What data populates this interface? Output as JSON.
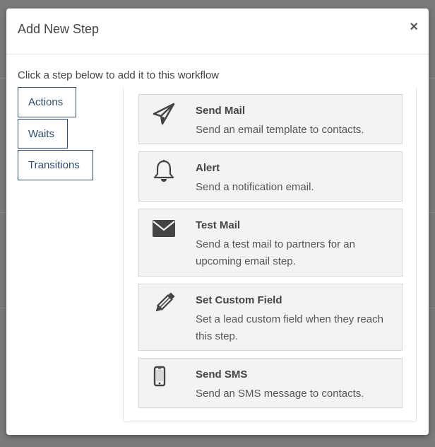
{
  "modal": {
    "title": "Add New Step",
    "close_label": "×",
    "instruction": "Click a step below to add it to this workflow"
  },
  "tabs": [
    {
      "label": "Actions"
    },
    {
      "label": "Waits"
    },
    {
      "label": "Transitions"
    }
  ],
  "steps": [
    {
      "title": "Send Mail",
      "description": "Send an email template to contacts.",
      "icon": "paper-plane-icon"
    },
    {
      "title": "Alert",
      "description": "Send a notification email.",
      "icon": "bell-icon"
    },
    {
      "title": "Test Mail",
      "description": "Send a test mail to partners for an upcoming email step.",
      "icon": "envelope-icon"
    },
    {
      "title": "Set Custom Field",
      "description": "Set a lead custom field when they reach this step.",
      "icon": "pencil-icon"
    },
    {
      "title": "Send SMS",
      "description": "Send an SMS message to contacts.",
      "icon": "mobile-phone-icon"
    }
  ],
  "colors": {
    "accent": "#2f4b6b",
    "card_bg": "#f3f3f3",
    "icon": "#444444"
  }
}
